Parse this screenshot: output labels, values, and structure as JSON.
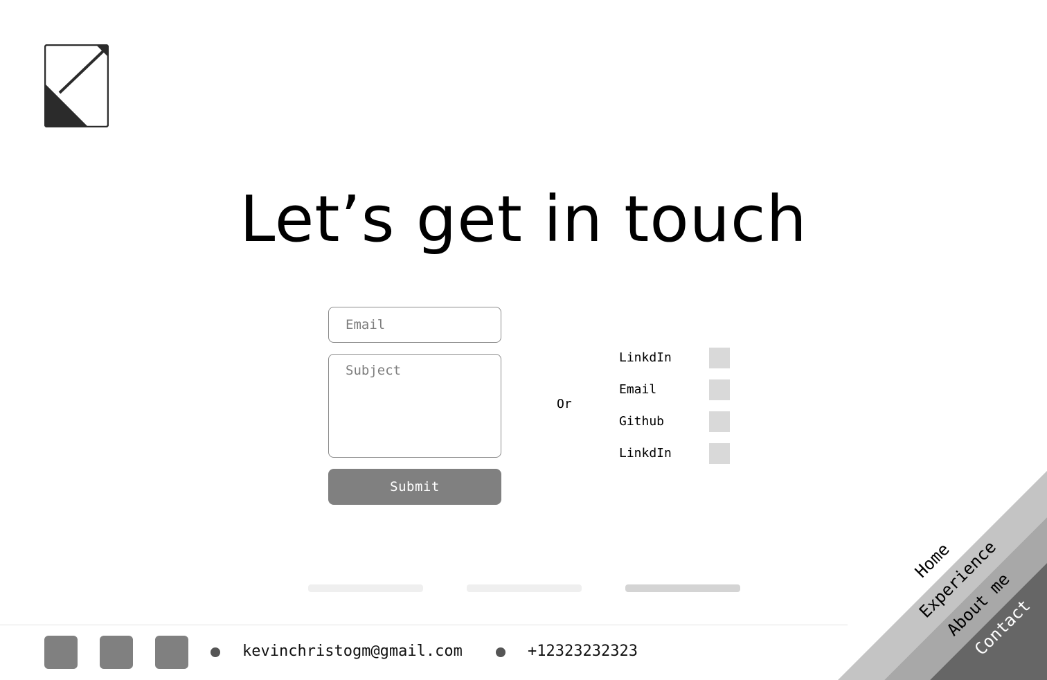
{
  "title": "Let’s get in touch",
  "form": {
    "email_placeholder": "Email",
    "subject_placeholder": "Subject",
    "submit_label": "Submit"
  },
  "or_label": "Or",
  "contacts": [
    {
      "label": "LinkdIn",
      "icon": "linkedin-icon"
    },
    {
      "label": "Email",
      "icon": "email-icon"
    },
    {
      "label": "Github",
      "icon": "github-icon"
    },
    {
      "label": "LinkdIn",
      "icon": "linkedin-icon"
    }
  ],
  "pager": {
    "count": 3,
    "active_index": 2
  },
  "footer": {
    "email": "kevinchristogm@gmail.com",
    "phone": "+12323232323",
    "socials": [
      "social-icon-1",
      "social-icon-2",
      "social-icon-3"
    ]
  },
  "nav": {
    "items": [
      "Home",
      "Experience",
      "About me",
      "Contact"
    ],
    "active": "Contact"
  },
  "colors": {
    "accent_gray": "#808080",
    "nav_light": "#c4c4c4",
    "nav_mid": "#a8a8a8",
    "nav_dark": "#666666",
    "logo": "#2b2b2b"
  }
}
